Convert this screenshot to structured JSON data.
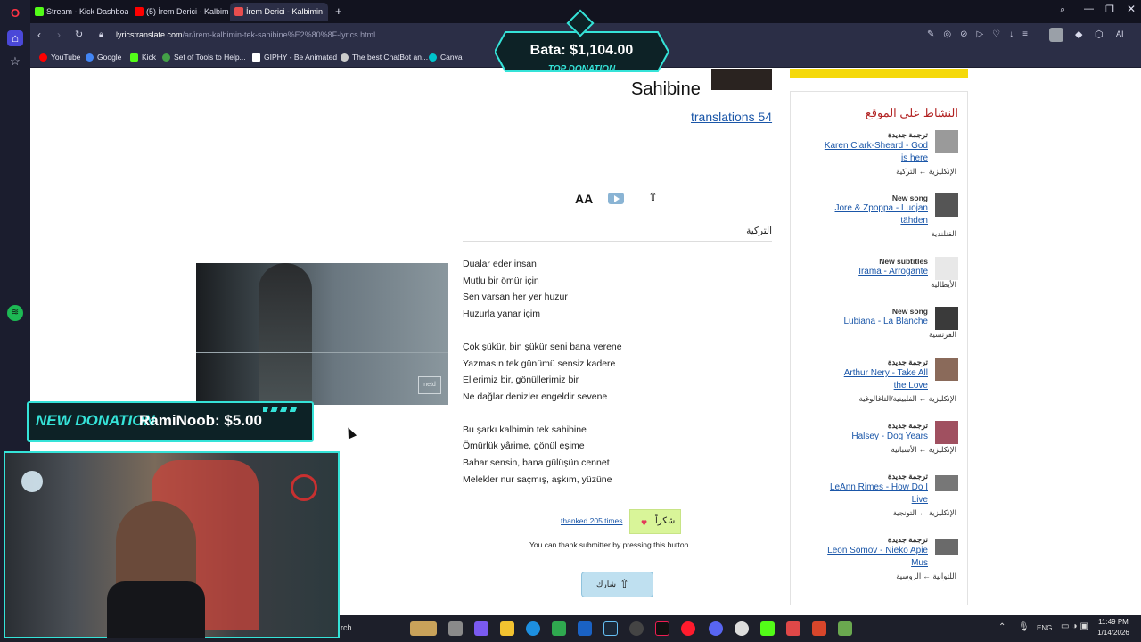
{
  "browser": {
    "tabs": [
      {
        "label": "Stream - Kick Dashboard",
        "color": "#53fc18"
      },
      {
        "label": "(5) İrem Derici - Kalbimin",
        "color": "#ff0000"
      },
      {
        "label": "İrem Derici - Kalbimin",
        "color": "#e94e4e"
      }
    ],
    "url_host": "lyricstranslate.com",
    "url_path": "/ar/irem-kalbimin-tek-sahibine%E2%80%8F-lyrics.html",
    "bookmarks": [
      {
        "label": "YouTube",
        "color": "#ff0000"
      },
      {
        "label": "Google",
        "color": "#4285f4"
      },
      {
        "label": "Kick",
        "color": "#53fc18"
      },
      {
        "label": "Set of Tools to Help...",
        "color": "#43a047"
      },
      {
        "label": "GIPHY - Be Animated",
        "color": "#ffffff"
      },
      {
        "label": "The best ChatBot an...",
        "color": "#cccccc"
      },
      {
        "label": "Canva",
        "color": "#00c4cc"
      }
    ]
  },
  "song": {
    "title_partial": "Sahibine",
    "translations_link": "translations 54",
    "language_label": "التركية",
    "lyrics_stanzas": [
      [
        "Dualar eder insan",
        "Mutlu bir ömür için",
        "Sen varsan her yer huzur",
        "Huzurla yanar içim"
      ],
      [
        "Çok şükür, bin şükür seni bana verene",
        "Yazmasın tek günümü sensiz kadere",
        "Ellerimiz bir, gönüllerimiz bir",
        "Ne dağlar denizler engeldir sevene"
      ],
      [
        "Bu şarkı kalbimin tek sahibine",
        "Ömürlük yârime, gönül eşime",
        "Bahar sensin, bana gülüşün cennet",
        "Melekler nur saçmış, aşkım, yüzüne"
      ]
    ],
    "thanked_text": "thanked 205 times",
    "thanks_button": "شكراً",
    "thank_hint": "You can thank submitter by pressing this button",
    "share_button": "شارك",
    "video_watermark": "netd"
  },
  "activity": {
    "heading": "النشاط على الموقع",
    "items": [
      {
        "type": "ترجمة جديدة",
        "link": [
          "Karen Clark-Sheard - God",
          "is here"
        ],
        "lang": "الإنكليزية ← التركية",
        "thumb": "#9a9a9a"
      },
      {
        "type": "New song",
        "link": [
          "Jore & Zpoppa - Luojan",
          "tähden"
        ],
        "lang": "الفنلندية",
        "thumb": "#555555"
      },
      {
        "type": "New subtitles",
        "link": [
          "Irama - Arrogante"
        ],
        "lang": "الأيطالية",
        "thumb": "#e8e8e8"
      },
      {
        "type": "New song",
        "link": [
          "Lubiana - La Blanche"
        ],
        "lang": "الفرنسية",
        "thumb": "#3a3a3a"
      },
      {
        "type": "ترجمة جديدة",
        "link": [
          "Arthur Nery - Take All",
          "the Love"
        ],
        "lang": "الإنكليزية ← الفلبينية/التاغالوغية",
        "thumb": "#8a6a5a"
      },
      {
        "type": "ترجمة جديدة",
        "link": [
          "Halsey - Dog Years"
        ],
        "lang": "الإنكليزية ← الأسبانية",
        "thumb": "#a05060"
      },
      {
        "type": "ترجمة جديدة",
        "link": [
          "LeAnn Rimes - How Do I",
          "Live"
        ],
        "lang": "الإنكليزية ← التونجية",
        "thumb": "#777777"
      },
      {
        "type": "ترجمة جديدة",
        "link": [
          "Leon Somov - Nieko Apie",
          "Mus"
        ],
        "lang": "اللتوانية ← الروسية",
        "thumb": "#6a6a6a"
      }
    ]
  },
  "overlay": {
    "top_donation_amount": "Bata: $1,104.00",
    "top_donation_label": "TOP DONATION",
    "new_donation_label": "NEW DONATION",
    "new_donation_value": "RamiNoob: $5.00"
  },
  "taskbar": {
    "search_fragment": "rch",
    "lang": "ENG",
    "time": "11:49 PM",
    "date": "1/14/2026"
  },
  "colors": {
    "accent": "#1a56a8",
    "heading_red": "#b22222",
    "overlay_cyan": "#35e3d8",
    "thanks_green": "#d9f599"
  }
}
